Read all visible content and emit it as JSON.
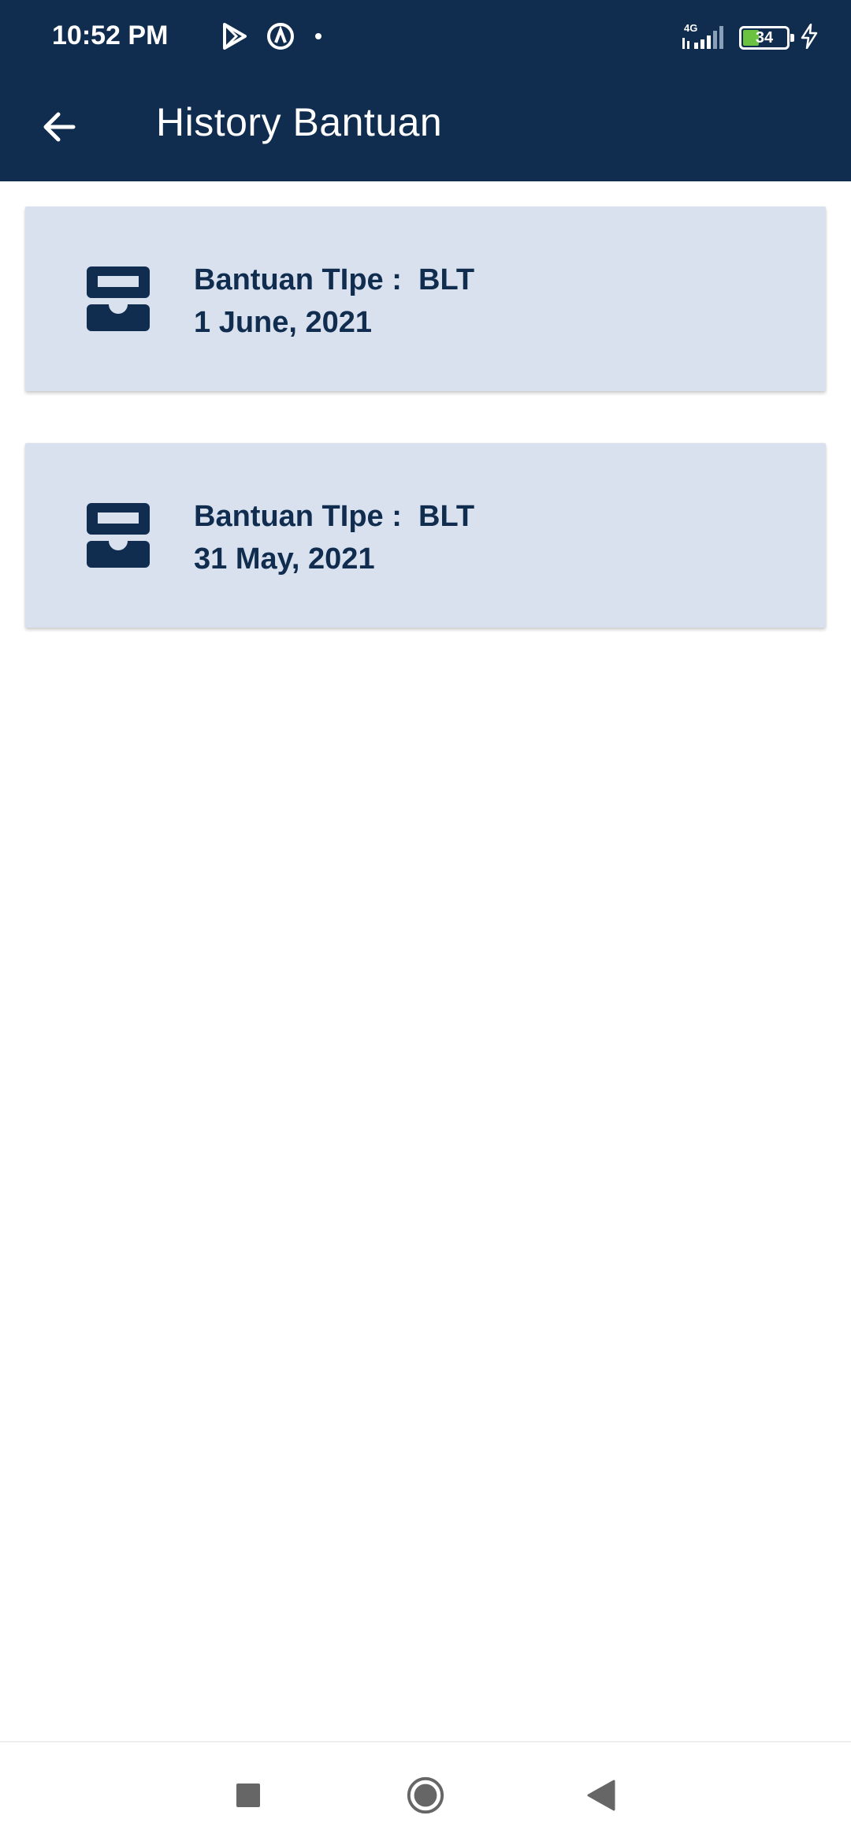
{
  "status_bar": {
    "time": "10:52 PM",
    "network": "4G",
    "battery_level": "34",
    "battery_fraction": 0.34,
    "battery_fill_color": "#6ac240",
    "icons": [
      "play-store-icon",
      "vpn-icon",
      "dot-icon",
      "signal-icon",
      "battery-icon",
      "charging-icon"
    ]
  },
  "app_bar": {
    "title": "History Bantuan",
    "back_icon": "arrow-left-icon",
    "background": "#102c4e"
  },
  "history": {
    "items": [
      {
        "type_label": "Bantuan TIpe :",
        "type_value": "BLT",
        "date": "1 June, 2021",
        "icon": "inbox-tray-icon"
      },
      {
        "type_label": "Bantuan TIpe :",
        "type_value": "BLT",
        "date": "31 May, 2021",
        "icon": "inbox-tray-icon"
      }
    ],
    "card_color": "#d9e1ee",
    "text_color": "#102c4e"
  },
  "nav_bar": {
    "buttons": [
      "recents-square-icon",
      "home-circle-icon",
      "back-triangle-icon"
    ]
  }
}
